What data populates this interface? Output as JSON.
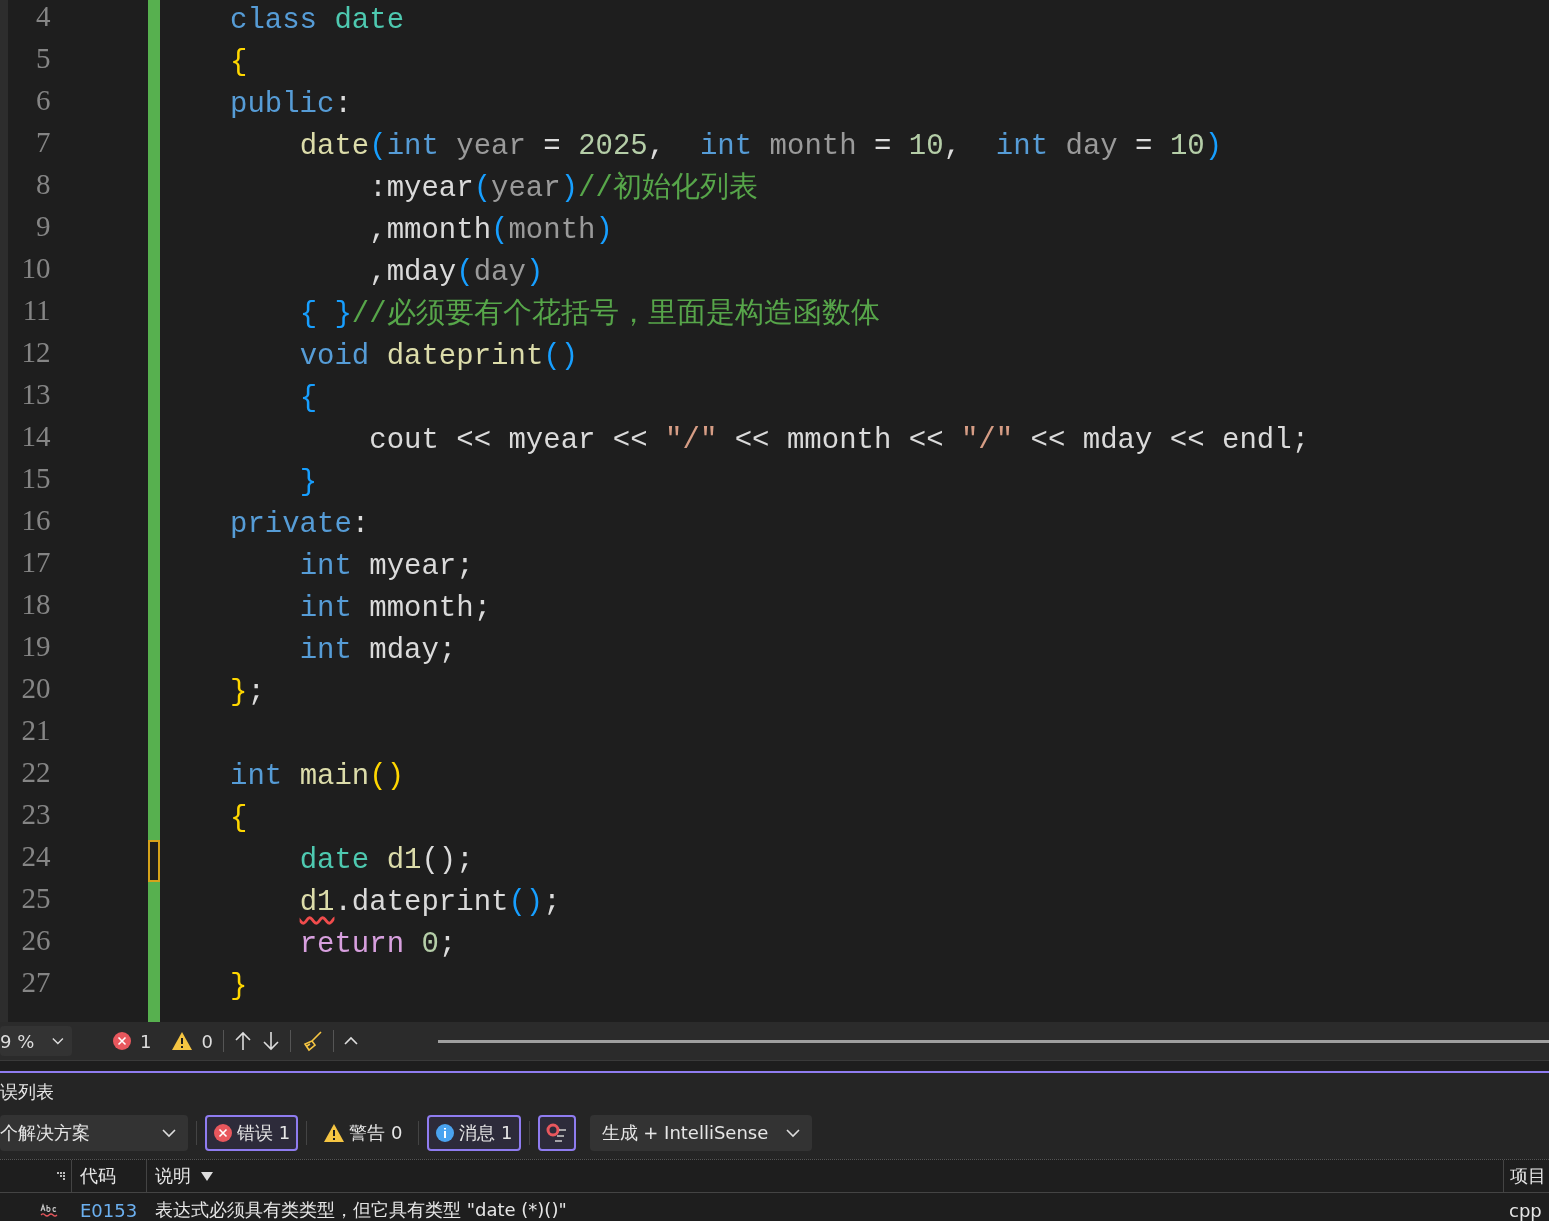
{
  "editor": {
    "lines": [
      {
        "number": "4",
        "current": false,
        "tokens": [
          {
            "text": "class",
            "kind": "keyword"
          },
          {
            "text": " date",
            "kind": "type"
          }
        ]
      },
      {
        "number": "5",
        "current": false,
        "tokens": [
          {
            "text": "{",
            "kind": "brace"
          }
        ]
      },
      {
        "number": "6",
        "current": false,
        "tokens": [
          {
            "text": "public",
            "kind": "keyword"
          },
          {
            "text": ":",
            "kind": "plain"
          }
        ]
      },
      {
        "number": "7",
        "current": false,
        "tokens": [
          {
            "text": "    date",
            "kind": "function"
          },
          {
            "text": "(",
            "kind": "paren"
          },
          {
            "text": "int",
            "kind": "keyword"
          },
          {
            "text": " year",
            "kind": "param"
          },
          {
            "text": " = ",
            "kind": "plain"
          },
          {
            "text": "2025",
            "kind": "number"
          },
          {
            "text": ",  ",
            "kind": "plain"
          },
          {
            "text": "int",
            "kind": "keyword"
          },
          {
            "text": " month",
            "kind": "param"
          },
          {
            "text": " = ",
            "kind": "plain"
          },
          {
            "text": "10",
            "kind": "number"
          },
          {
            "text": ",  ",
            "kind": "plain"
          },
          {
            "text": "int",
            "kind": "keyword"
          },
          {
            "text": " day",
            "kind": "param"
          },
          {
            "text": " = ",
            "kind": "plain"
          },
          {
            "text": "10",
            "kind": "number"
          },
          {
            "text": ")",
            "kind": "paren"
          }
        ]
      },
      {
        "number": "8",
        "current": false,
        "tokens": [
          {
            "text": "        :myear",
            "kind": "member"
          },
          {
            "text": "(",
            "kind": "paren"
          },
          {
            "text": "year",
            "kind": "param"
          },
          {
            "text": ")",
            "kind": "paren"
          },
          {
            "text": "//初始化列表",
            "kind": "comment"
          }
        ]
      },
      {
        "number": "9",
        "current": false,
        "tokens": [
          {
            "text": "        ,mmonth",
            "kind": "member"
          },
          {
            "text": "(",
            "kind": "paren"
          },
          {
            "text": "month",
            "kind": "param"
          },
          {
            "text": ")",
            "kind": "paren"
          }
        ]
      },
      {
        "number": "10",
        "current": false,
        "tokens": [
          {
            "text": "        ,mday",
            "kind": "member"
          },
          {
            "text": "(",
            "kind": "paren"
          },
          {
            "text": "day",
            "kind": "param"
          },
          {
            "text": ")",
            "kind": "paren"
          }
        ]
      },
      {
        "number": "11",
        "current": false,
        "tokens": [
          {
            "text": "    { }",
            "kind": "paren"
          },
          {
            "text": "//必须要有个花括号，里面是构造函数体",
            "kind": "comment"
          }
        ]
      },
      {
        "number": "12",
        "current": false,
        "tokens": [
          {
            "text": "    void",
            "kind": "keyword"
          },
          {
            "text": " dateprint",
            "kind": "function"
          },
          {
            "text": "()",
            "kind": "paren"
          }
        ]
      },
      {
        "number": "13",
        "current": false,
        "tokens": [
          {
            "text": "    {",
            "kind": "paren"
          }
        ]
      },
      {
        "number": "14",
        "current": false,
        "tokens": [
          {
            "text": "        cout << myear << ",
            "kind": "member"
          },
          {
            "text": "\"/\"",
            "kind": "string"
          },
          {
            "text": " << mmonth << ",
            "kind": "member"
          },
          {
            "text": "\"/\"",
            "kind": "string"
          },
          {
            "text": " << mday << endl;",
            "kind": "member"
          }
        ]
      },
      {
        "number": "15",
        "current": false,
        "tokens": [
          {
            "text": "    }",
            "kind": "paren"
          }
        ]
      },
      {
        "number": "16",
        "current": false,
        "tokens": [
          {
            "text": "private",
            "kind": "keyword"
          },
          {
            "text": ":",
            "kind": "plain"
          }
        ]
      },
      {
        "number": "17",
        "current": false,
        "tokens": [
          {
            "text": "    int",
            "kind": "keyword"
          },
          {
            "text": " myear;",
            "kind": "member"
          }
        ]
      },
      {
        "number": "18",
        "current": false,
        "tokens": [
          {
            "text": "    int",
            "kind": "keyword"
          },
          {
            "text": " mmonth;",
            "kind": "member"
          }
        ]
      },
      {
        "number": "19",
        "current": false,
        "tokens": [
          {
            "text": "    int",
            "kind": "keyword"
          },
          {
            "text": " mday;",
            "kind": "member"
          }
        ]
      },
      {
        "number": "20",
        "current": false,
        "tokens": [
          {
            "text": "}",
            "kind": "brace"
          },
          {
            "text": ";",
            "kind": "plain"
          }
        ]
      },
      {
        "number": "21",
        "current": false
      },
      {
        "number": "22",
        "current": false,
        "tokens": [
          {
            "text": "int",
            "kind": "keyword"
          },
          {
            "text": " main",
            "kind": "function"
          },
          {
            "text": "()",
            "kind": "brace"
          }
        ]
      },
      {
        "number": "23",
        "current": false,
        "tokens": [
          {
            "text": "{",
            "kind": "brace"
          }
        ]
      },
      {
        "number": "24",
        "current": true,
        "tokens": [
          {
            "text": "    date",
            "kind": "type"
          },
          {
            "text": " d1",
            "kind": "variable"
          },
          {
            "text": "()",
            "kind": "plain"
          },
          {
            "text": ";",
            "kind": "plain"
          }
        ]
      },
      {
        "number": "25",
        "current": false,
        "tokens": [
          {
            "text": "    d1",
            "kind": "error"
          },
          {
            "text": ".dateprint",
            "kind": "member"
          },
          {
            "text": "()",
            "kind": "paren"
          },
          {
            "text": ";",
            "kind": "plain"
          }
        ]
      },
      {
        "number": "26",
        "current": false,
        "tokens": [
          {
            "text": "    return",
            "kind": "control"
          },
          {
            "text": " 0",
            "kind": "number"
          },
          {
            "text": ";",
            "kind": "plain"
          }
        ]
      },
      {
        "number": "27",
        "current": false,
        "tokens": [
          {
            "text": "}",
            "kind": "brace"
          }
        ]
      }
    ]
  },
  "status_bar": {
    "zoom": "9 %",
    "errors": "1",
    "warnings": "0"
  },
  "error_list": {
    "title": "误列表",
    "scope": "个解决方案",
    "filters": [
      {
        "kind": "error",
        "label": "错误 1",
        "selected": true
      },
      {
        "kind": "warning",
        "label": "警告 0",
        "selected": false
      },
      {
        "kind": "message",
        "label": "消息 1",
        "selected": true
      },
      {
        "kind": "toggle",
        "selected": true
      }
    ],
    "source": "生成 + IntelliSense",
    "columns": [
      "代码",
      "说明",
      "项目"
    ],
    "rows": [
      {
        "code": "E0153",
        "description": "表达式必须具有类类型，但它具有类型 \"date (*)()\"",
        "project": "cpp"
      }
    ]
  }
}
